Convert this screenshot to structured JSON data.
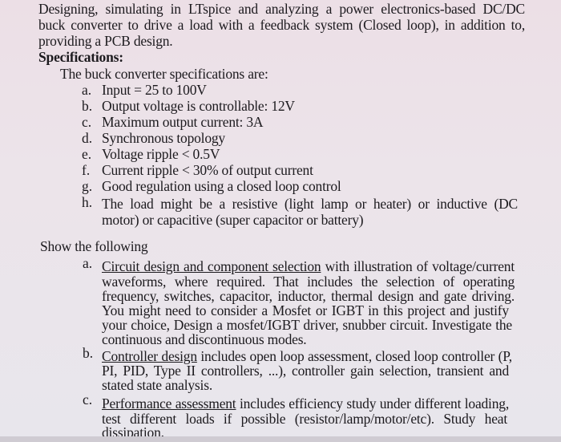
{
  "intro": {
    "line1": "Designing, simulating in LTspice and analyzing a power electronics-based DC/DC",
    "line2": "buck converter to drive a load with a feedback system (Closed loop), in addition to,",
    "line3": "providing a PCB design."
  },
  "specifications": {
    "heading": "Specifications:",
    "lead": "The buck converter specifications are:",
    "items": [
      {
        "marker": "a.",
        "text": "Input = 25 to 100V"
      },
      {
        "marker": "b.",
        "text": "Output voltage is controllable: 12V"
      },
      {
        "marker": "c.",
        "text": "Maximum output current: 3A"
      },
      {
        "marker": "d.",
        "text": "Synchronous topology"
      },
      {
        "marker": "e.",
        "text": "Voltage ripple < 0.5V"
      },
      {
        "marker": "f.",
        "text": "Current ripple < 30% of output current"
      },
      {
        "marker": "g.",
        "text": "Good regulation using a closed loop control"
      },
      {
        "marker": "h.",
        "line1": "The load might be a resistive (light lamp or heater) or inductive (DC",
        "line2": "motor) or capacitive (super capacitor or battery)"
      }
    ]
  },
  "show": {
    "heading": "Show the following",
    "items": [
      {
        "marker": "a.",
        "title": "Circuit design and component selection",
        "line1_rest": " with illustration of voltage/current",
        "lines": [
          "waveforms, where required. That includes the selection of operating",
          "frequency, switches, capacitor, inductor, thermal design and gate driving.",
          "You might need to consider a Mosfet or IGBT in this project and justify",
          "your choice, Design a mosfet/IGBT driver, snubber circuit. Investigate the",
          "continuous and discontinuous modes."
        ]
      },
      {
        "marker": "b.",
        "title": "Controller design",
        "line1_rest": " includes open loop assessment, closed loop controller (P,",
        "lines": [
          "PI, PID, Type II controllers, ...), controller gain selection, transient and",
          "stated state analysis."
        ]
      },
      {
        "marker": "c.",
        "title": "Performance assessment",
        "line1_rest": " includes efficiency study under different loading,",
        "lines": [
          "test different loads if possible (resistor/lamp/motor/etc). Study heat",
          "dissipation."
        ]
      }
    ]
  }
}
